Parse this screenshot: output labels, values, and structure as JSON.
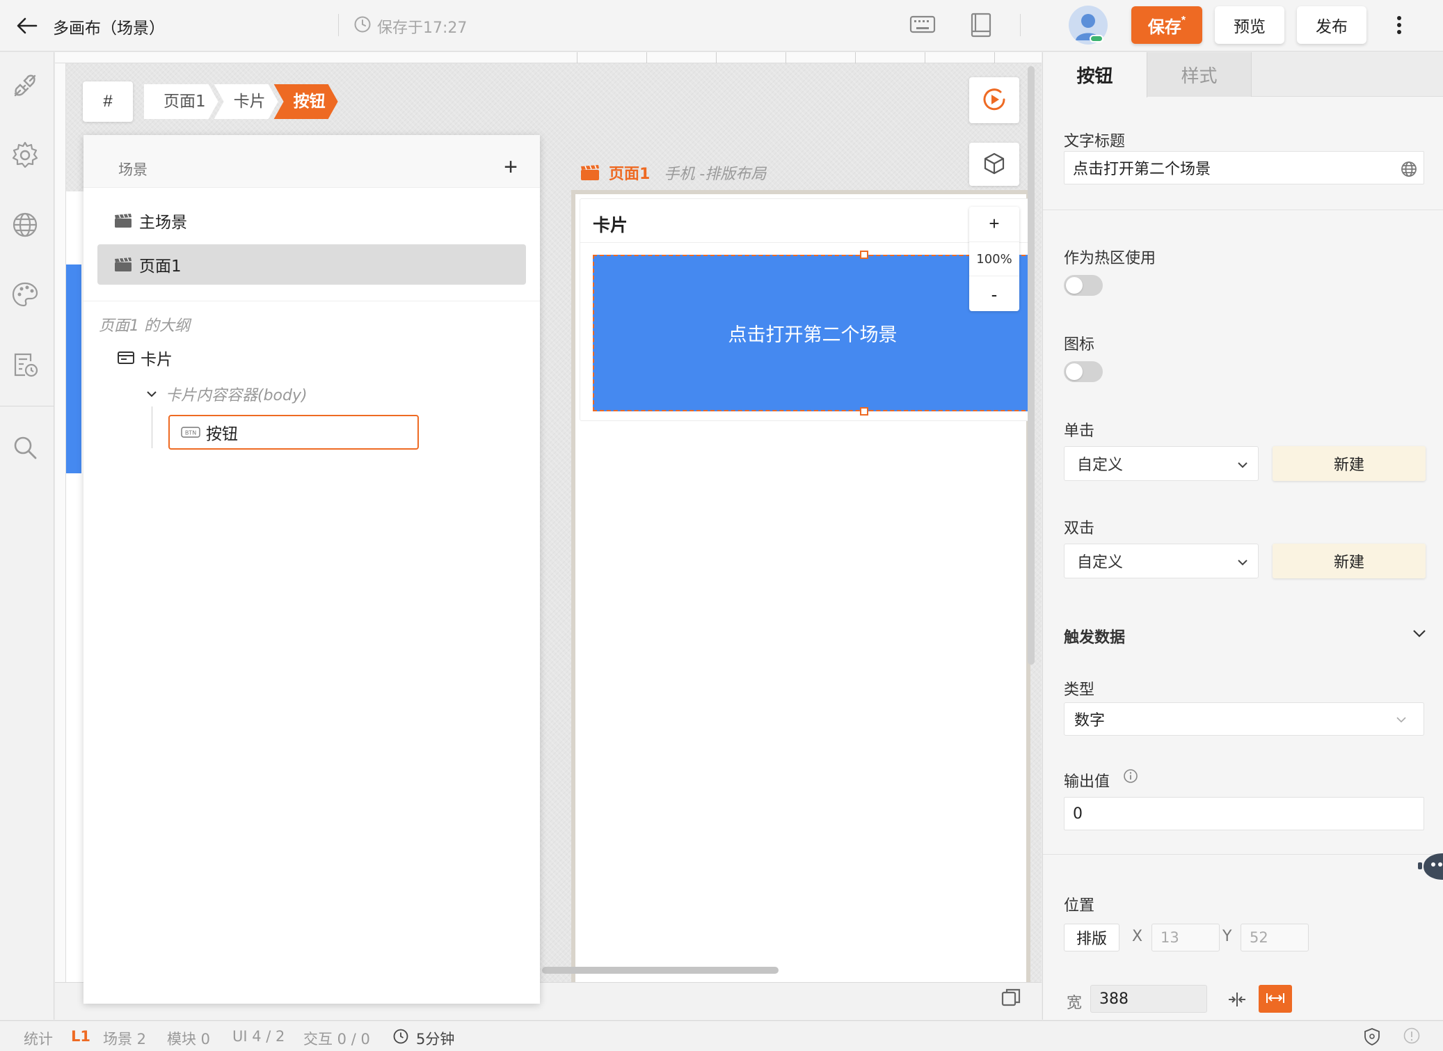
{
  "topbar": {
    "title": "多画布（场景）",
    "saved_status": "保存于17:27",
    "save_label": "保存",
    "save_dirty_mark": "*",
    "preview_label": "预览",
    "publish_label": "发布"
  },
  "breadcrumb": {
    "hash_label": "#",
    "items": [
      "页面1",
      "卡片",
      "按钮"
    ]
  },
  "scene_panel": {
    "header": "场景",
    "add_label": "+",
    "scenes": [
      "主场景",
      "页面1"
    ],
    "selected_scene": "页面1",
    "outline_title": "页面1 的大纲",
    "tree": {
      "card": "卡片",
      "body": "卡片内容容器(body)",
      "button": "按钮"
    }
  },
  "canvas": {
    "page_name": "页面1",
    "page_layout": "手机 -排版布局",
    "card_title": "卡片",
    "button_text": "点击打开第二个场景",
    "zoom_in": "+",
    "zoom_level": "100%",
    "zoom_out": "-"
  },
  "properties": {
    "tabs": [
      "按钮",
      "样式"
    ],
    "active_tab": "按钮",
    "text_title_label": "文字标题",
    "text_title_value": "点击打开第二个场景",
    "hotspot_label": "作为热区使用",
    "hotspot_enabled": false,
    "icon_label": "图标",
    "icon_enabled": false,
    "click_label": "单击",
    "click_value": "自定义",
    "click_new": "新建",
    "dblclick_label": "双击",
    "dblclick_value": "自定义",
    "dblclick_new": "新建",
    "trigger_section": "触发数据",
    "type_label": "类型",
    "type_value": "数字",
    "output_label": "输出值",
    "output_value": "0",
    "position_label": "位置",
    "layout_btn": "排版",
    "x_label": "X",
    "x_value": "13",
    "y_label": "Y",
    "y_value": "52",
    "width_label": "宽",
    "width_value": "388"
  },
  "statusbar": {
    "stats": "统计",
    "level": "L1",
    "scenes": "场景 2",
    "modules": "模块 0",
    "ui": "UI 4 / 2",
    "interactions": "交互 0 / 0",
    "time": "5分钟"
  },
  "colors": {
    "accent": "#ee6a23",
    "button_blue": "#4589f0"
  }
}
